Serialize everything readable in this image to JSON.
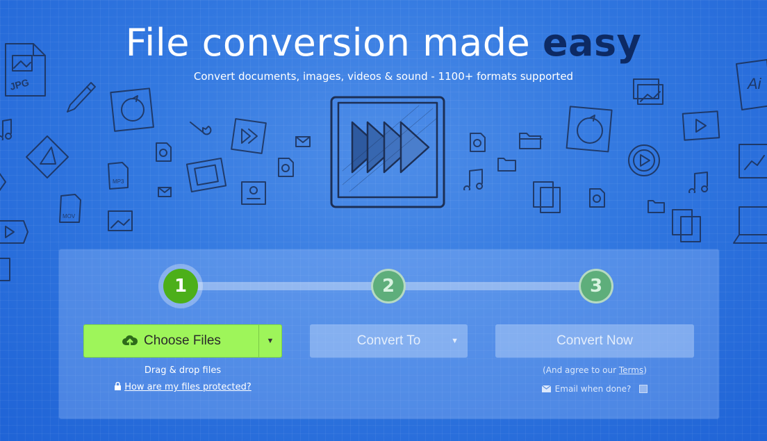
{
  "hero": {
    "title_main": "File conversion made ",
    "title_accent": "easy",
    "subtitle": "Convert documents, images, videos & sound - 1100+ formats supported"
  },
  "steps": [
    {
      "number": "1",
      "state": "active"
    },
    {
      "number": "2",
      "state": "pending"
    },
    {
      "number": "3",
      "state": "pending"
    }
  ],
  "upload": {
    "choose_label": "Choose Files",
    "drag_text": "Drag & drop files",
    "protected_link": "How are my files protected?"
  },
  "convert_to": {
    "label": "Convert To"
  },
  "convert_now": {
    "label": "Convert Now",
    "terms_prefix": "(And agree to our ",
    "terms_link": "Terms",
    "terms_suffix": ")",
    "email_label": "Email when done?"
  },
  "decor": {
    "jpg_label": "JPG",
    "mp3_label": "MP3",
    "mov_label": "MOV",
    "ai_label": "Ai"
  },
  "colors": {
    "background": "#3278e0",
    "accent_dark": "#0d2a64",
    "choose_button": "#9ef55a",
    "step_active": "#4caf1a",
    "step_pending": "#5eae7b"
  }
}
